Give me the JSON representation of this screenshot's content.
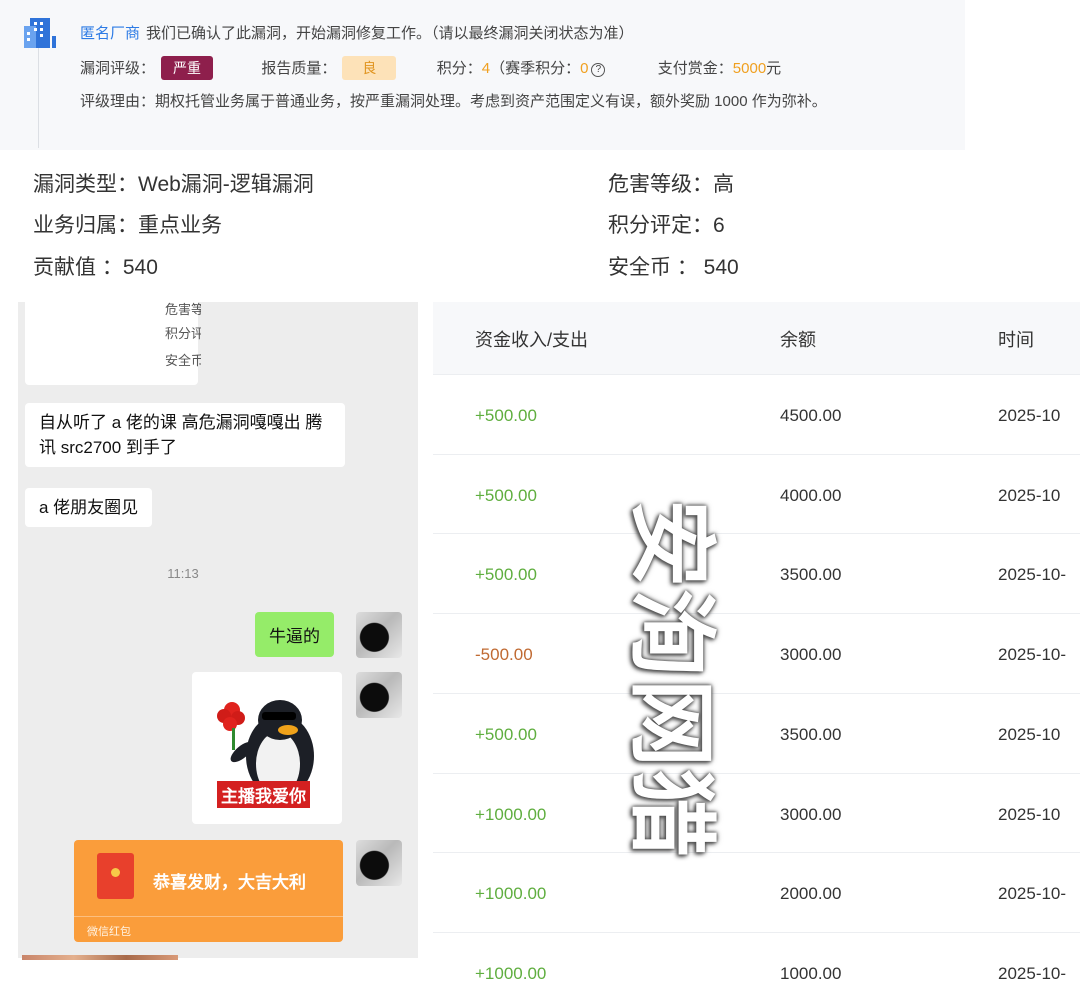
{
  "vendor": {
    "name": "匿名厂商",
    "message": "我们已确认了此漏洞，开始漏洞修复工作。（请以最终漏洞关闭状态为准）",
    "rating_label": "漏洞评级：",
    "rating_value": "严重",
    "quality_label": "报告质量：",
    "quality_value": "良",
    "points_label": "积分：",
    "points_value": "4",
    "season_label": "（赛季积分：",
    "season_value": "0",
    "help_glyph": "?",
    "bounty_label": "支付赏金：",
    "bounty_value": "5000",
    "bounty_unit": "元",
    "reason": "评级理由：期权托管业务属于普通业务，按严重漏洞处理。考虑到资产范围定义有误，额外奖励 1000 作为弥补。"
  },
  "info": {
    "type": "漏洞类型：Web漏洞-逻辑漏洞",
    "dept": "业务归属：重点业务",
    "contrib": "贡献值  ：540",
    "harm": "危害等级：高",
    "score": "积分评定：6",
    "coin": "安全币  ：  540"
  },
  "chat": {
    "clip_lines": [
      "危害等级",
      "积分评定",
      "安全币"
    ],
    "msg1": "自从听了 a 佬的课 高危漏洞嘎嘎出 腾讯 src2700 到手了",
    "msg2": "a 佬朋友圈见",
    "time": "11:13",
    "out_msg": "牛逼的",
    "sticker_caption": "主播我爱你",
    "redpacket_title": "恭喜发财，大吉大利",
    "redpacket_label": "微信红包"
  },
  "ledger": {
    "headers": [
      "资金收入/支出",
      "余额",
      "时间"
    ],
    "rows": [
      {
        "amount": "+500.00",
        "balance": "4500.00",
        "time": "2025-10"
      },
      {
        "amount": "+500.00",
        "balance": "4000.00",
        "time": "2025-10"
      },
      {
        "amount": "+500.00",
        "balance": "3500.00",
        "time": "2025-10-"
      },
      {
        "amount": "-500.00",
        "balance": "3000.00",
        "time": "2025-10-"
      },
      {
        "amount": "+500.00",
        "balance": "3500.00",
        "time": "2025-10"
      },
      {
        "amount": "+1000.00",
        "balance": "3000.00",
        "time": "2025-10"
      },
      {
        "amount": "+1000.00",
        "balance": "2000.00",
        "time": "2025-10-"
      },
      {
        "amount": "+1000.00",
        "balance": "1000.00",
        "time": "2025-10-"
      }
    ]
  },
  "watermark": [
    "安",
    "洵",
    "网",
    "猎"
  ],
  "colors": {
    "link_blue": "#2d7be5",
    "severe_purple": "#8e1f4c",
    "quality_orange": "#e0941f",
    "income_green": "#5fae3f",
    "expense_brown": "#c06a32",
    "chat_green": "#95ec69",
    "redpacket_orange": "#fa9d3b"
  }
}
